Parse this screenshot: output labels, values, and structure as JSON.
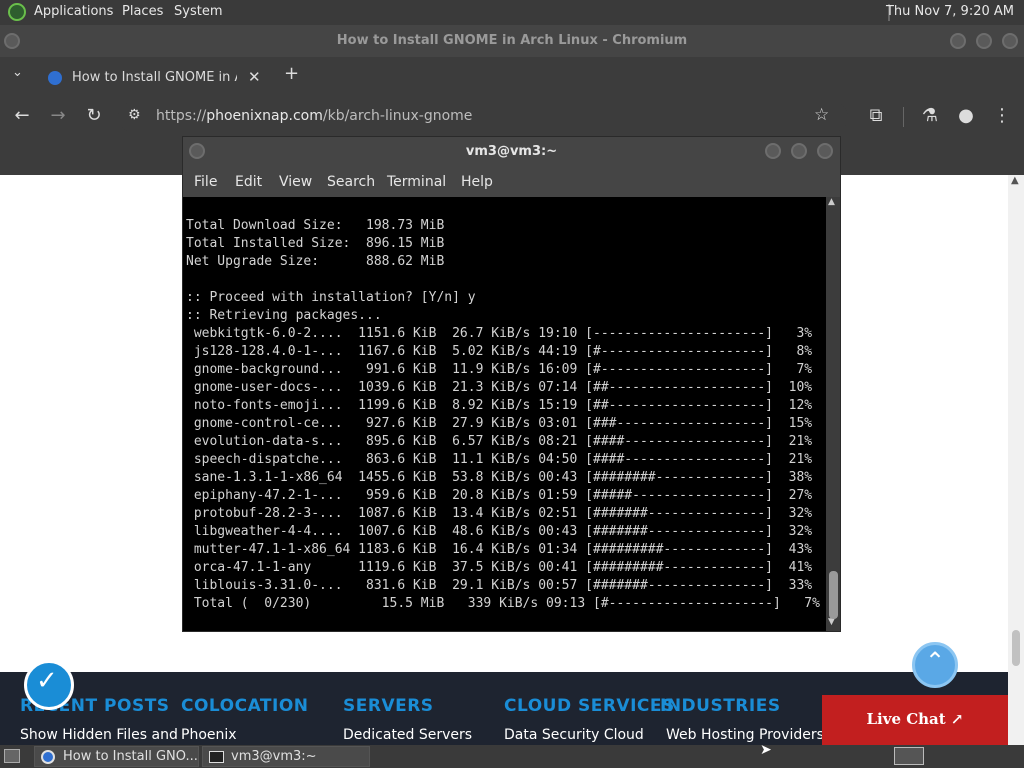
{
  "top_panel": {
    "applications_label": "Applications",
    "places_label": "Places",
    "system_label": "System",
    "clock": "Thu Nov 7,  9:20 AM"
  },
  "browser": {
    "window_title": "How to Install GNOME in Arch Linux - Chromium",
    "tab_title": "How to Install GNOME in Arc",
    "url_prefix": "https://",
    "url_host": "phoenixnap.com",
    "url_path": "/kb/arch-linux-gnome"
  },
  "page": {
    "footer_titles": [
      "RECENT POSTS",
      "COLOCATION",
      "SERVERS",
      "CLOUD SERVICES",
      "INDUSTRIES"
    ],
    "footer_links": [
      "Show Hidden Files and",
      "Phoenix",
      "Dedicated Servers",
      "Data Security Cloud",
      "Web Hosting Providers"
    ],
    "live_chat_label": "Live Chat ↗"
  },
  "terminal": {
    "title": "vm3@vm3:~",
    "menu": [
      "File",
      "Edit",
      "View",
      "Search",
      "Terminal",
      "Help"
    ],
    "lines": [
      "Total Download Size:   198.73 MiB",
      "Total Installed Size:  896.15 MiB",
      "Net Upgrade Size:      888.62 MiB",
      "",
      ":: Proceed with installation? [Y/n] y",
      ":: Retrieving packages...",
      " webkitgtk-6.0-2....  1151.6 KiB  26.7 KiB/s 19:10 [----------------------]   3%",
      " js128-128.4.0-1-...  1167.6 KiB  5.02 KiB/s 44:19 [#---------------------]   8%",
      " gnome-background...   991.6 KiB  11.9 KiB/s 16:09 [#---------------------]   7%",
      " gnome-user-docs-...  1039.6 KiB  21.3 KiB/s 07:14 [##--------------------]  10%",
      " noto-fonts-emoji...  1199.6 KiB  8.92 KiB/s 15:19 [##--------------------]  12%",
      " gnome-control-ce...   927.6 KiB  27.9 KiB/s 03:01 [###-------------------]  15%",
      " evolution-data-s...   895.6 KiB  6.57 KiB/s 08:21 [####------------------]  21%",
      " speech-dispatche...   863.6 KiB  11.1 KiB/s 04:50 [####------------------]  21%",
      " sane-1.3.1-1-x86_64  1455.6 KiB  53.8 KiB/s 00:43 [########--------------]  38%",
      " epiphany-47.2-1-...   959.6 KiB  20.8 KiB/s 01:59 [#####-----------------]  27%",
      " protobuf-28.2-3-...  1087.6 KiB  13.4 KiB/s 02:51 [#######---------------]  32%",
      " libgweather-4-4....  1007.6 KiB  48.6 KiB/s 00:43 [#######---------------]  32%",
      " mutter-47.1-1-x86_64 1183.6 KiB  16.4 KiB/s 01:34 [#########-------------]  43%",
      " orca-47.1-1-any      1119.6 KiB  37.5 KiB/s 00:41 [#########-------------]  41%",
      " liblouis-3.31.0-...   831.6 KiB  29.1 KiB/s 00:57 [#######---------------]  33%",
      " Total (  0/230)         15.5 MiB   339 KiB/s 09:13 [#---------------------]   7%"
    ]
  },
  "taskbar": {
    "tasks": [
      "How to Install GNO...",
      "vm3@vm3:~"
    ]
  }
}
